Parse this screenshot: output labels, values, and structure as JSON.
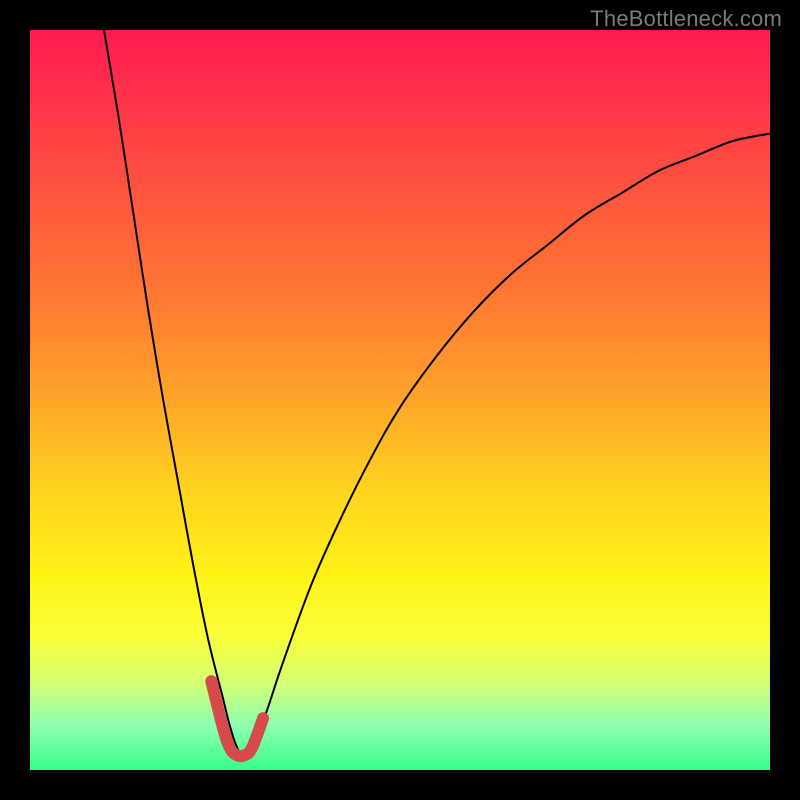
{
  "watermark": {
    "text": "TheBottleneck.com"
  },
  "chart_data": {
    "type": "line",
    "title": "",
    "xlabel": "",
    "ylabel": "",
    "xlim": [
      0,
      100
    ],
    "ylim": [
      0,
      100
    ],
    "grid": false,
    "series": [
      {
        "name": "bottleneck-curve",
        "x": [
          10,
          12,
          14,
          16,
          18,
          20,
          22,
          24,
          26,
          27,
          28,
          29,
          30,
          32,
          34,
          38,
          42,
          46,
          50,
          55,
          60,
          65,
          70,
          75,
          80,
          85,
          90,
          95,
          100
        ],
        "values": [
          100,
          88,
          75,
          62,
          50,
          39,
          28,
          18,
          10,
          6,
          3,
          2,
          3,
          8,
          14,
          25,
          34,
          42,
          49,
          56,
          62,
          67,
          71,
          75,
          78,
          81,
          83,
          85,
          86
        ]
      },
      {
        "name": "optimal-range-highlight",
        "x": [
          24.5,
          26,
          27,
          28,
          29,
          30,
          31.5
        ],
        "values": [
          12,
          6,
          3,
          2,
          2,
          3,
          7
        ]
      }
    ],
    "colors": {
      "curve": "#000000",
      "highlight": "#d64a4a",
      "gradient_top": "#ff1a52",
      "gradient_bottom": "#38ff88"
    }
  }
}
